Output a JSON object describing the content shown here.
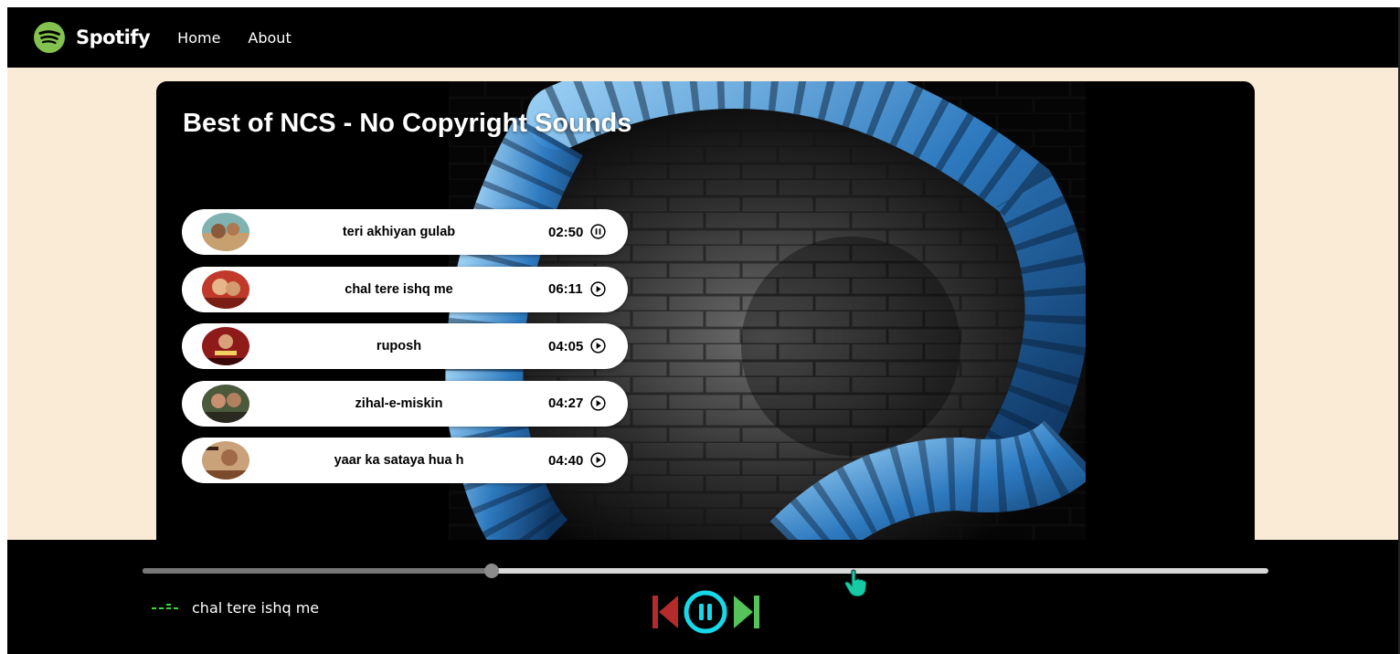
{
  "nav": {
    "brand": "Spotify",
    "links": [
      "Home",
      "About"
    ],
    "logo_icon": "spotify-logo-icon",
    "logo_color": "#84c250"
  },
  "playlist": {
    "title": "Best of NCS - No Copyright Sounds"
  },
  "songs": [
    {
      "name": "teri akhiyan gulab",
      "duration": "02:50",
      "state_icon": "pause-circle-icon"
    },
    {
      "name": "chal tere ishq me",
      "duration": "06:11",
      "state_icon": "play-circle-icon"
    },
    {
      "name": "ruposh",
      "duration": "04:05",
      "state_icon": "play-circle-icon"
    },
    {
      "name": "zihal-e-miskin",
      "duration": "04:27",
      "state_icon": "play-circle-icon"
    },
    {
      "name": "yaar ka sataya hua h",
      "duration": "04:40",
      "state_icon": "play-circle-icon"
    }
  ],
  "player": {
    "now_playing": "chal tere ishq me",
    "progress_fraction": 0.31,
    "controls": {
      "prev_icon": "skip-previous-icon",
      "play_pause_icon": "pause-circle-icon",
      "next_icon": "skip-next-icon"
    },
    "colors": {
      "prev": "#b52a2a",
      "play": "#16d8e8",
      "next": "#56c25a",
      "equalizer": "#3adb3a"
    }
  }
}
